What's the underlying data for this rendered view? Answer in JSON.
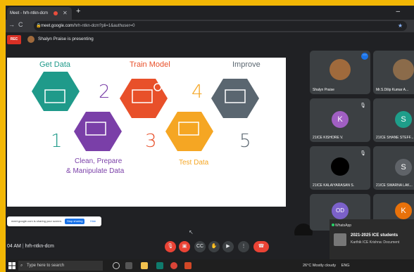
{
  "browser": {
    "tab_title": "Meet - hrh-ntkn-dcm",
    "new_tab": "+",
    "url_host": "meet.google.com",
    "url_path": "/hrh-ntkn-dcm?pli=1&authuser=0"
  },
  "meet": {
    "rec_label": "REC",
    "presenting_text": "Shalyn Praise is presenting",
    "meeting_time": "04 AM",
    "meeting_code": "hrh-ntkn-dcm"
  },
  "slide": {
    "steps": [
      {
        "label": "Get Data",
        "number": "1",
        "color": "#1f9a8a"
      },
      {
        "label": "Clean, Prepare",
        "label2": "& Manipulate Data",
        "number": "2",
        "color": "#7a3fa8"
      },
      {
        "label": "Train Model",
        "number": "3",
        "color": "#e8502a"
      },
      {
        "label": "Test Data",
        "number": "4",
        "color": "#f5a623"
      },
      {
        "label": "Improve",
        "number": "5",
        "color": "#5a6670"
      }
    ]
  },
  "share_toast": {
    "message": "meet.google.com is sharing your screen.",
    "stop_label": "Stop sharing",
    "hide_label": "Hide"
  },
  "participants": [
    {
      "name": "Shalyn Praise",
      "initial": "",
      "color": "#a06a3c"
    },
    {
      "name": "Mr.S.Dilip Kumar A...",
      "initial": "",
      "color": "#8b6b4a"
    },
    {
      "name": "21ICE KISHORE V.",
      "initial": "K",
      "color": "#a05fc2"
    },
    {
      "name": "21ICE SHANE STEFF...",
      "initial": "S",
      "color": "#1e9e8a"
    },
    {
      "name": "21ICE KALAIYARASAN S.",
      "initial": "",
      "color": "#000000"
    },
    {
      "name": "21ICE SWARNA LAK...",
      "initial": "S",
      "color": "#5f6368"
    },
    {
      "name": "",
      "initial": "OD",
      "color": "#7b61c9"
    },
    {
      "name": "",
      "initial": "K",
      "color": "#e8710a"
    }
  ],
  "whatsapp": {
    "app": "WhatsApp",
    "title": "2021-2025 ICE students",
    "body": "Karthik ICE Krishna: Document"
  },
  "taskbar": {
    "search_placeholder": "Type here to search",
    "weather": "26°C  Mostly cloudy",
    "lang": "ENG"
  }
}
